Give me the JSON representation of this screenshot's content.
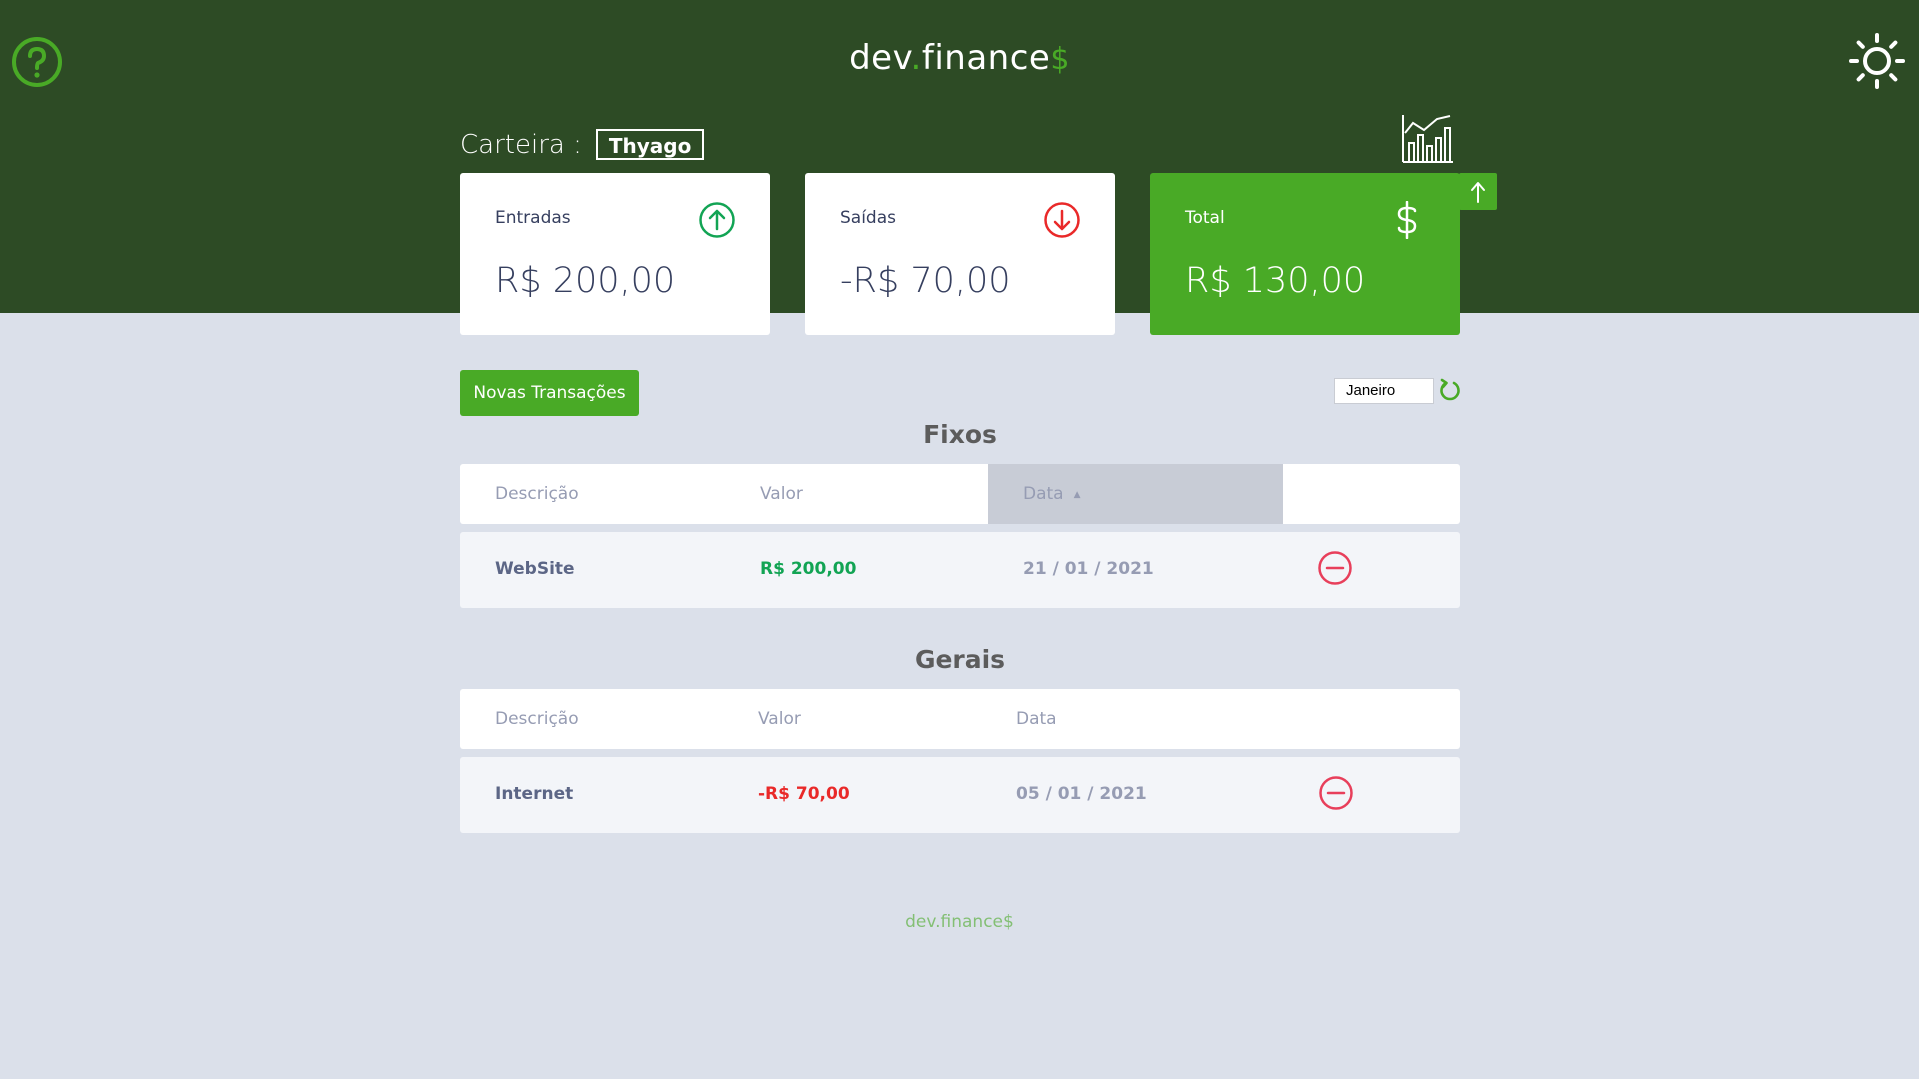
{
  "header": {
    "logo_main": "dev",
    "logo_dot": ".",
    "logo_rest": "finance",
    "logo_dollar": "$",
    "help_icon": "question-circle-icon",
    "theme_icon": "sun-icon",
    "chart_icon": "bar-chart-icon"
  },
  "wallet": {
    "label": "Carteira :",
    "name": "Thyago"
  },
  "cards": {
    "income": {
      "label": "Entradas",
      "value": "R$ 200,00",
      "icon": "arrow-up-circle-icon"
    },
    "expense": {
      "label": "Saídas",
      "value": "-R$ 70,00",
      "icon": "arrow-down-circle-icon"
    },
    "total": {
      "label": "Total",
      "value": "R$ 130,00",
      "icon": "dollar-icon"
    }
  },
  "actions": {
    "new_transaction": "Novas Transações",
    "month": "Janeiro"
  },
  "fixed": {
    "title": "Fixos",
    "columns": [
      "Descrição",
      "Valor",
      "Data"
    ],
    "sort_indicator": "▲",
    "rows": [
      {
        "description": "WebSite",
        "amount": "R$ 200,00",
        "date": "21 / 01 / 2021"
      }
    ]
  },
  "general": {
    "title": "Gerais",
    "columns": [
      "Descrição",
      "Valor",
      "Data"
    ],
    "rows": [
      {
        "description": "Internet",
        "amount": "-R$ 70,00",
        "date": "05 / 01 / 2021"
      }
    ]
  },
  "footer": {
    "text": "dev.finance$"
  },
  "colors": {
    "header_bg": "#2d4b25",
    "accent": "#49aa26",
    "income": "#12a454",
    "expense": "#e92929",
    "page_bg": "#dbe0ea"
  }
}
